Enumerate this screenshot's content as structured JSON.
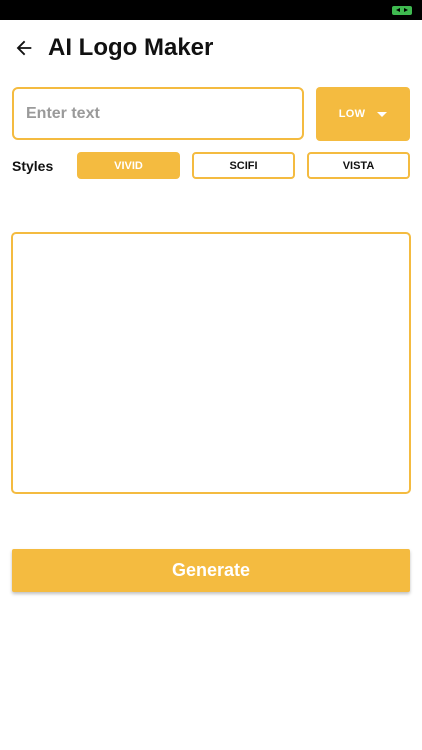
{
  "app_bar": {
    "title": "AI Logo Maker",
    "back_icon": "arrow-left-icon"
  },
  "status_bar": {
    "battery_icon": "battery-charging-icon",
    "battery_color": "#3fb950"
  },
  "input": {
    "placeholder": "Enter text",
    "value": ""
  },
  "quality": {
    "selected": "LOW",
    "icon": "caret-down-icon"
  },
  "styles": {
    "label": "Styles",
    "options": [
      {
        "label": "VIVID",
        "selected": true
      },
      {
        "label": "SCIFI",
        "selected": false
      },
      {
        "label": "VISTA",
        "selected": false
      }
    ]
  },
  "generate_button": {
    "label": "Generate"
  },
  "colors": {
    "accent": "#f4bb40",
    "text": "#111111",
    "placeholder": "#9a9a9a",
    "on_accent": "#ffffff"
  }
}
